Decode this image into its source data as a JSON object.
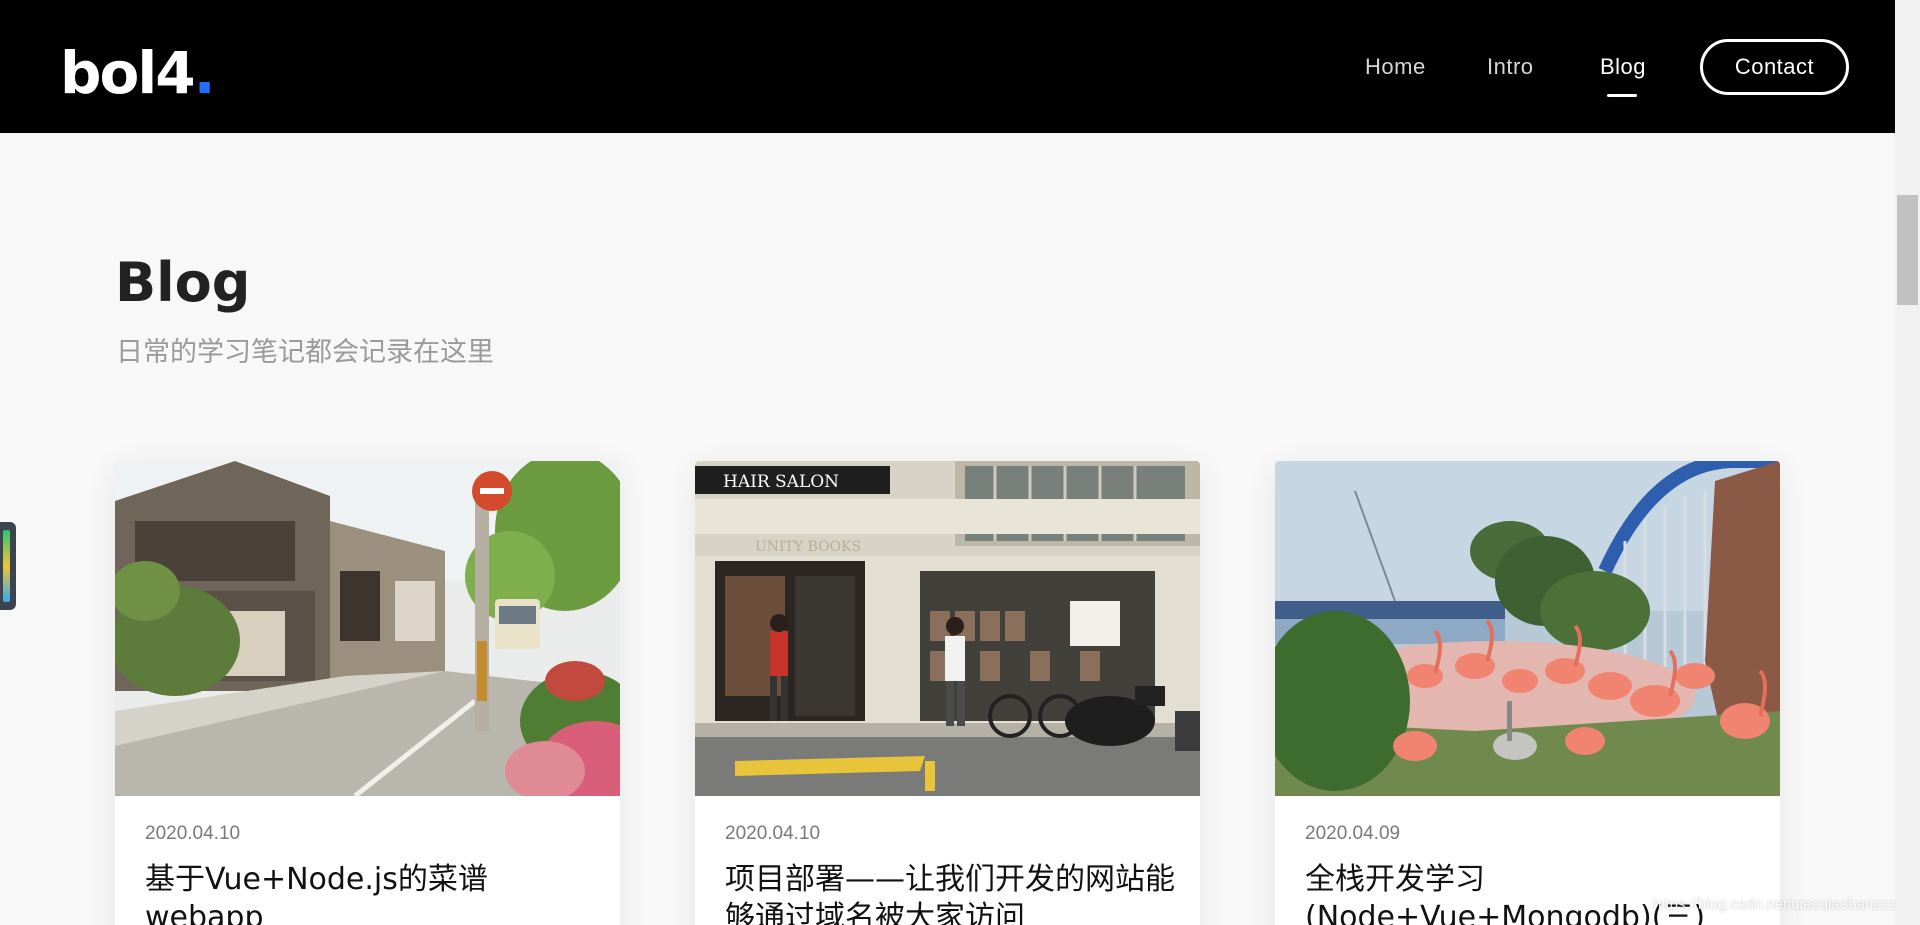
{
  "header": {
    "logo": "bol4",
    "logo_dot": ".",
    "nav": [
      {
        "label": "Home"
      },
      {
        "label": "Intro"
      },
      {
        "label": "Blog",
        "active": true
      }
    ],
    "contact_label": "Contact"
  },
  "page": {
    "title": "Blog",
    "subtitle": "日常的学习笔记都会记录在这里"
  },
  "posts": [
    {
      "date": "2020.04.10",
      "title": "基于Vue+Node.js的菜谱webapp",
      "image": "japanese-street-photo"
    },
    {
      "date": "2020.04.10",
      "title": "项目部署——让我们开发的网站能够通过域名被大家访问",
      "image": "hair-salon-bookshop-photo"
    },
    {
      "date": "2020.04.09",
      "title": "全栈开发学习(Node+Vue+Mongodb)(三)",
      "image": "flamingo-park-photo"
    }
  ],
  "watermark": "https://blog.csdn.net/qiaoqiaobanzzz",
  "colors": {
    "header_bg": "#000000",
    "accent_dot": "#1e6fff",
    "page_bg": "#f8f8f8"
  }
}
